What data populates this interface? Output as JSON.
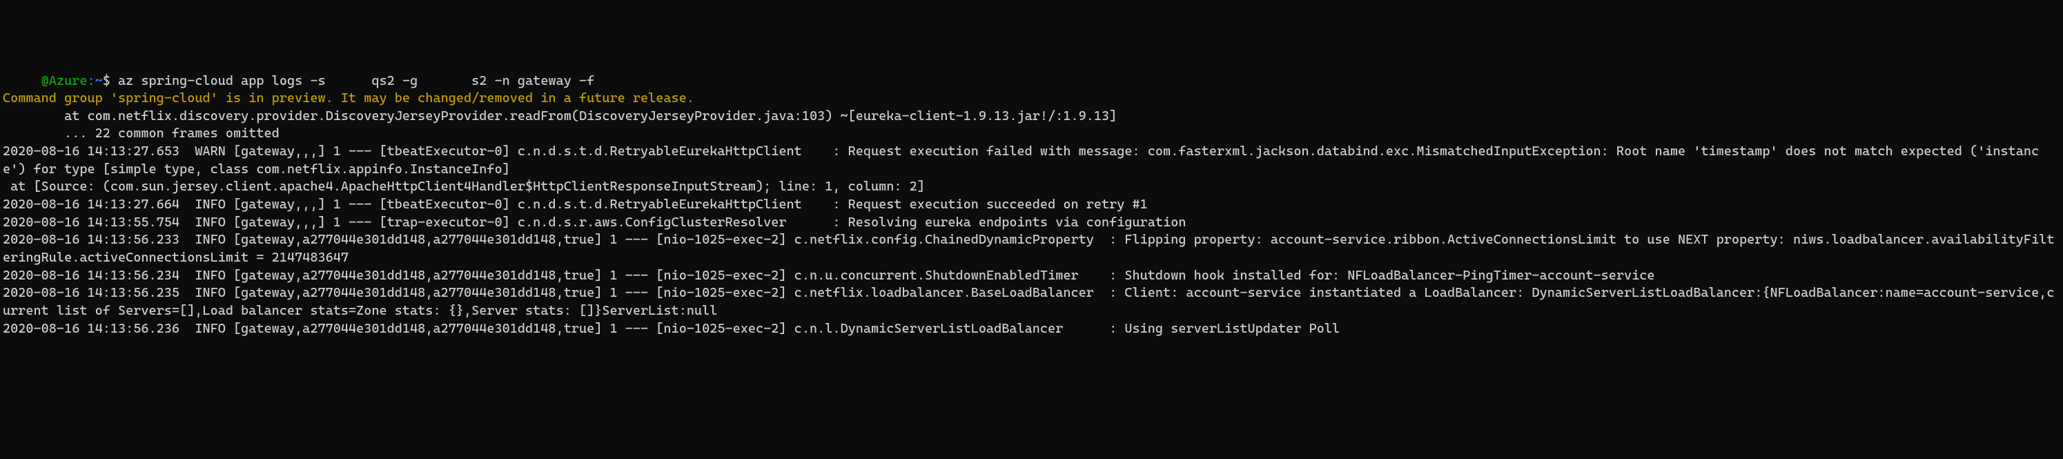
{
  "prompt": {
    "user_at": "     @Azure",
    "colon": ":",
    "tilde": "~",
    "dollar": "$"
  },
  "command": " az spring-cloud app logs -s      qs2 -g       s2 -n gateway -f",
  "warning": "Command group 'spring-cloud' is in preview. It may be changed/removed in a future release.",
  "log_lines": [
    "        at com.netflix.discovery.provider.DiscoveryJerseyProvider.readFrom(DiscoveryJerseyProvider.java:103) ~[eureka-client-1.9.13.jar!/:1.9.13]",
    "        ... 22 common frames omitted",
    "",
    "2020-08-16 14:13:27.653  WARN [gateway,,,] 1 --- [tbeatExecutor-0] c.n.d.s.t.d.RetryableEurekaHttpClient    : Request execution failed with message: com.fasterxml.jackson.databind.exc.MismatchedInputException: Root name 'timestamp' does not match expected ('instance') for type [simple type, class com.netflix.appinfo.InstanceInfo]",
    " at [Source: (com.sun.jersey.client.apache4.ApacheHttpClient4Handler$HttpClientResponseInputStream); line: 1, column: 2]",
    "2020-08-16 14:13:27.664  INFO [gateway,,,] 1 --- [tbeatExecutor-0] c.n.d.s.t.d.RetryableEurekaHttpClient    : Request execution succeeded on retry #1",
    "2020-08-16 14:13:55.754  INFO [gateway,,,] 1 --- [trap-executor-0] c.n.d.s.r.aws.ConfigClusterResolver      : Resolving eureka endpoints via configuration",
    "2020-08-16 14:13:56.233  INFO [gateway,a277044e301dd148,a277044e301dd148,true] 1 --- [nio-1025-exec-2] c.netflix.config.ChainedDynamicProperty  : Flipping property: account-service.ribbon.ActiveConnectionsLimit to use NEXT property: niws.loadbalancer.availabilityFilteringRule.activeConnectionsLimit = 2147483647",
    "2020-08-16 14:13:56.234  INFO [gateway,a277044e301dd148,a277044e301dd148,true] 1 --- [nio-1025-exec-2] c.n.u.concurrent.ShutdownEnabledTimer    : Shutdown hook installed for: NFLoadBalancer-PingTimer-account-service",
    "2020-08-16 14:13:56.235  INFO [gateway,a277044e301dd148,a277044e301dd148,true] 1 --- [nio-1025-exec-2] c.netflix.loadbalancer.BaseLoadBalancer  : Client: account-service instantiated a LoadBalancer: DynamicServerListLoadBalancer:{NFLoadBalancer:name=account-service,current list of Servers=[],Load balancer stats=Zone stats: {},Server stats: []}ServerList:null",
    "2020-08-16 14:13:56.236  INFO [gateway,a277044e301dd148,a277044e301dd148,true] 1 --- [nio-1025-exec-2] c.n.l.DynamicServerListLoadBalancer      : Using serverListUpdater Poll"
  ]
}
